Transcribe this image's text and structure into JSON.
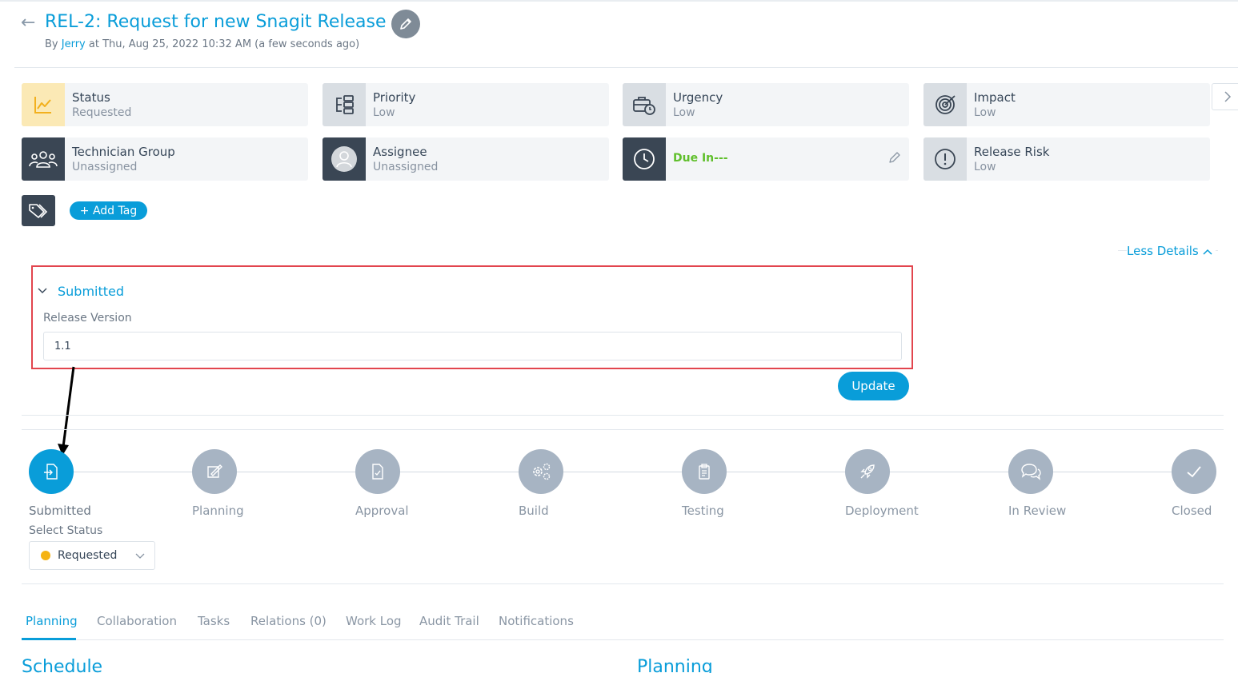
{
  "header": {
    "back_icon": "arrow-left-icon",
    "title": "REL-2: Request for new Snagit Release",
    "edit_icon": "pencil-icon",
    "meta_by": "By",
    "meta_user": "Jerry",
    "meta_at": "at Thu, Aug 25, 2022 10:32 AM (a few seconds ago)"
  },
  "cards": [
    {
      "label": "Status",
      "value": "Requested",
      "icon": "chart-line-icon"
    },
    {
      "label": "Priority",
      "value": "Low",
      "icon": "priority-flow-icon"
    },
    {
      "label": "Urgency",
      "value": "Low",
      "icon": "briefcase-clock-icon"
    },
    {
      "label": "Impact",
      "value": "Low",
      "icon": "target-icon"
    },
    {
      "label": "Technician Group",
      "value": "Unassigned",
      "icon": "users-icon"
    },
    {
      "label": "Assignee",
      "value": "Unassigned",
      "icon": "avatar-icon"
    },
    {
      "label": "Due In---",
      "value": "",
      "icon": "clock-icon"
    },
    {
      "label": "Release Risk",
      "value": "Low",
      "icon": "exclamation-icon"
    }
  ],
  "tags": {
    "add_label": "+ Add Tag",
    "icon": "tag-icon"
  },
  "details_toggle": "Less Details",
  "section": {
    "title": "Submitted",
    "field_label": "Release Version",
    "field_value": "1.1"
  },
  "update_label": "Update",
  "stages": [
    {
      "label": "Submitted",
      "icon": "submit-doc-icon",
      "active": true
    },
    {
      "label": "Planning",
      "icon": "planning-icon",
      "active": false
    },
    {
      "label": "Approval",
      "icon": "approval-doc-icon",
      "active": false
    },
    {
      "label": "Build",
      "icon": "gears-icon",
      "active": false
    },
    {
      "label": "Testing",
      "icon": "clipboard-icon",
      "active": false
    },
    {
      "label": "Deployment",
      "icon": "rocket-icon",
      "active": false
    },
    {
      "label": "In Review",
      "icon": "chat-icon",
      "active": false
    },
    {
      "label": "Closed",
      "icon": "check-icon",
      "active": false
    }
  ],
  "status_select": {
    "label": "Select Status",
    "value": "Requested",
    "color": "#f5b313"
  },
  "tabs": [
    "Planning",
    "Collaboration",
    "Tasks",
    "Relations (0)",
    "Work Log",
    "Audit Trail",
    "Notifications"
  ],
  "bottom_headings": [
    "Schedule",
    "Planning"
  ],
  "colors": {
    "accent": "#099dd9",
    "highlight_border": "#e2454e",
    "due_green": "#5fbf2b"
  }
}
